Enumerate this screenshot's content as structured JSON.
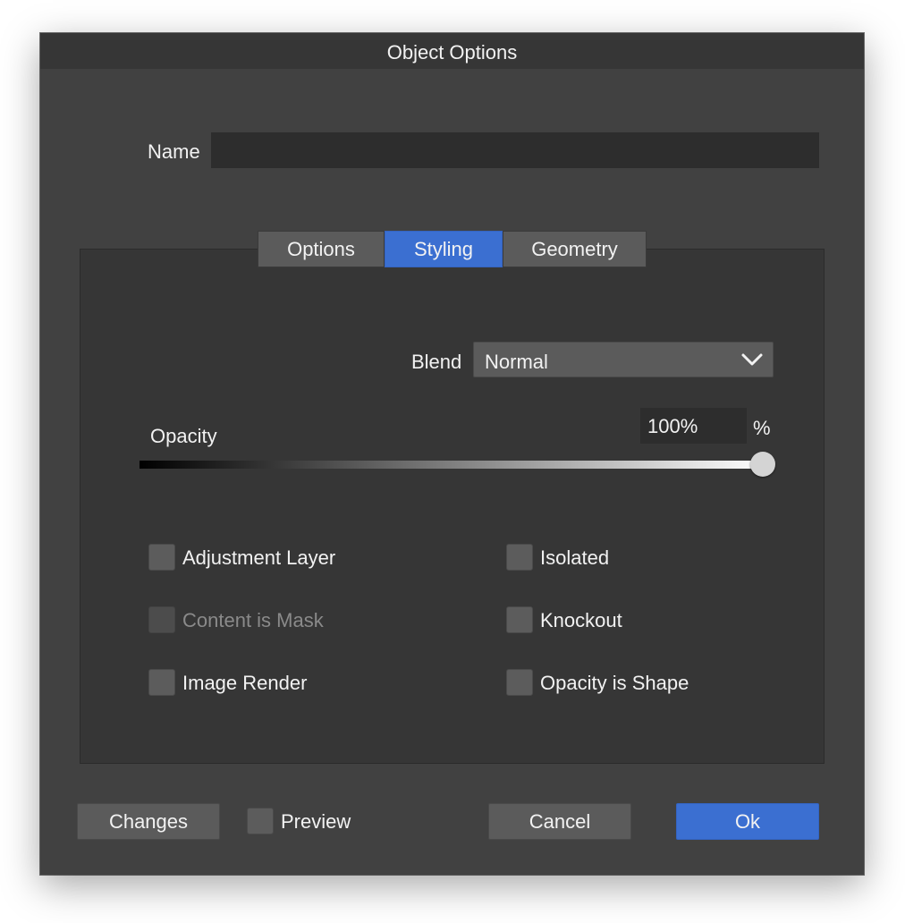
{
  "window": {
    "title": "Object Options"
  },
  "name_field": {
    "label": "Name",
    "value": ""
  },
  "tabs": [
    {
      "label": "Options",
      "active": false
    },
    {
      "label": "Styling",
      "active": true
    },
    {
      "label": "Geometry",
      "active": false
    }
  ],
  "styling": {
    "blend": {
      "label": "Blend",
      "value": "Normal"
    },
    "opacity": {
      "label": "Opacity",
      "value": "100%",
      "unit": "%",
      "level": 1.0
    },
    "checkboxes": [
      {
        "label": "Adjustment Layer",
        "checked": false,
        "disabled": false
      },
      {
        "label": "Content is Mask",
        "checked": false,
        "disabled": true
      },
      {
        "label": "Image Render",
        "checked": false,
        "disabled": false
      },
      {
        "label": "Isolated",
        "checked": false,
        "disabled": false
      },
      {
        "label": "Knockout",
        "checked": false,
        "disabled": false
      },
      {
        "label": "Opacity is Shape",
        "checked": false,
        "disabled": false
      }
    ]
  },
  "footer": {
    "changes_label": "Changes",
    "preview_label": "Preview",
    "cancel_label": "Cancel",
    "ok_label": "Ok"
  },
  "colors": {
    "accent": "#3b6fd1",
    "window_bg": "#414141",
    "panel_bg": "#363636"
  }
}
